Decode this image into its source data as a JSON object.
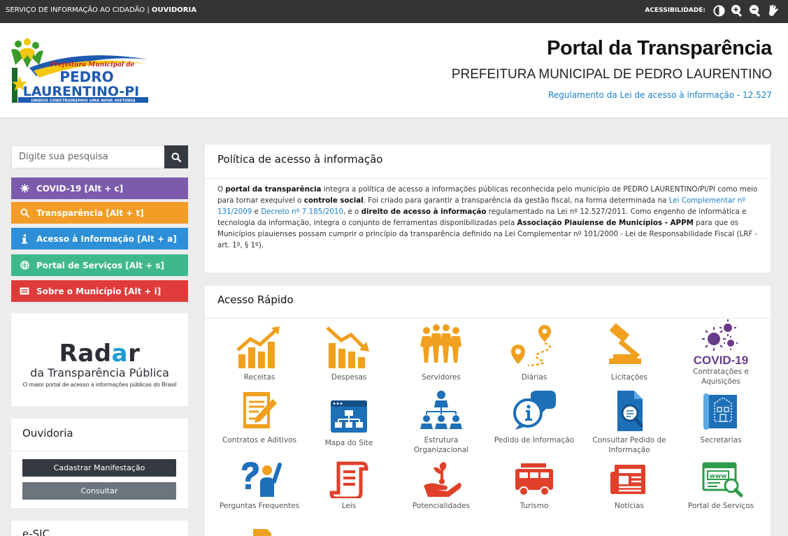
{
  "topbar": {
    "left_text": "SERVIÇO DE INFORMAÇÃO AO CIDADÃO | ",
    "left_bold": "OUVIDORIA",
    "acc_label": "ACESSIBILIDADE:"
  },
  "logo": {
    "line1": "Prefeitura Municipal de",
    "line2": "PEDRO",
    "line3": "LAURENTINO-PI",
    "line4": "UNIDOS CONSTRUIREMOS UMA NOVA HISTÓRIA"
  },
  "header": {
    "title": "Portal da Transparência",
    "subtitle": "PREFEITURA MUNICIPAL DE PEDRO LAURENTINO",
    "link": "Regulamento da Lei de acesso à informação - 12.527"
  },
  "search": {
    "placeholder": "Digite sua pesquisa"
  },
  "menu": [
    {
      "label": "COVID-19 [Alt + c]",
      "icon": "virus-icon",
      "color": "#7c5bad"
    },
    {
      "label": "Transparência [Alt + t]",
      "icon": "search-icon",
      "color": "#f39c26"
    },
    {
      "label": "Acesso à Informação [Alt + a]",
      "icon": "info-icon",
      "color": "#2c8fd8"
    },
    {
      "label": "Portal de Serviços [Alt + s]",
      "icon": "globe-icon",
      "color": "#3fb98b"
    },
    {
      "label": "Sobre o Município [Alt + i]",
      "icon": "card-icon",
      "color": "#e03b3b"
    }
  ],
  "radar": {
    "title_a": "Rad",
    "title_b": "a",
    "title_c": "r",
    "subtitle": "da Transparência Pública",
    "tagline": "O maior portal de acesso a informações públicas do Brasil"
  },
  "ouvidoria": {
    "title": "Ouvidoria",
    "btn_cadastrar": "Cadastrar Manifestação",
    "btn_consultar": "Consultar"
  },
  "esic": {
    "title": "e-SIC"
  },
  "politica": {
    "title": "Política de acesso à informação",
    "text": {
      "s1": "O ",
      "b1": "portal da transparência",
      "s2": " integra a política de acesso a informações públicas reconhecida pelo município de PEDRO LAURENTINO/PI/PI como meio para tornar exequível o ",
      "b2": "controle social",
      "s3": ". Foi criado para garantir a transparência da gestão fiscal, na forma determinada na ",
      "a1": "Lei Complementar nº 131/2009",
      "s4": " e ",
      "a2": "Decreto nº 7.185/2010",
      "s5": ", e o ",
      "b3": "direito de acesso à informação",
      "s6": " regulamentado na Lei nº 12.527/2011. Como engenho de informática e tecnologia da informação, integra o conjunto de ferramentas disponibilizadas pela ",
      "b4": "Associação Piauiense de Municípios - APPM",
      "s7": " para que os Municípios piauienses possam cumprir o princípio da transparência definido na Lei Complementar nº 101/2000 - Lei de Responsabilidade Fiscal (LRF - art. 1º, § 1º)."
    }
  },
  "rapido": {
    "title": "Acesso Rápido",
    "tiles": [
      {
        "label": "Receitas",
        "icon": "revenue-chart-icon"
      },
      {
        "label": "Despesas",
        "icon": "expenses-chart-icon"
      },
      {
        "label": "Servidores",
        "icon": "people-icon"
      },
      {
        "label": "Diárias",
        "icon": "route-pin-icon"
      },
      {
        "label": "Licitações",
        "icon": "gavel-icon"
      },
      {
        "label": "Contratações e Aquisições",
        "icon": "covid-19-icon",
        "banner": "COVID-19"
      },
      {
        "label": "Contratos e Aditivos",
        "icon": "contract-pen-icon"
      },
      {
        "label": "Mapa do Site",
        "icon": "sitemap-icon"
      },
      {
        "label": "Estrutura Organizacional",
        "icon": "org-chart-icon"
      },
      {
        "label": "Pedido de Informação",
        "icon": "info-bubble-icon"
      },
      {
        "label": "Consultar Pedido de Informação",
        "icon": "document-search-icon"
      },
      {
        "label": "Secretarias",
        "icon": "building-plan-icon"
      },
      {
        "label": "Perguntas Frequentes",
        "icon": "question-person-icon"
      },
      {
        "label": "Leis",
        "icon": "scroll-icon"
      },
      {
        "label": "Potencialidades",
        "icon": "plant-hand-icon"
      },
      {
        "label": "Turismo",
        "icon": "bus-icon"
      },
      {
        "label": "Notícias",
        "icon": "newspaper-icon"
      },
      {
        "label": "Portal de Serviços",
        "icon": "www-search-icon"
      }
    ]
  }
}
